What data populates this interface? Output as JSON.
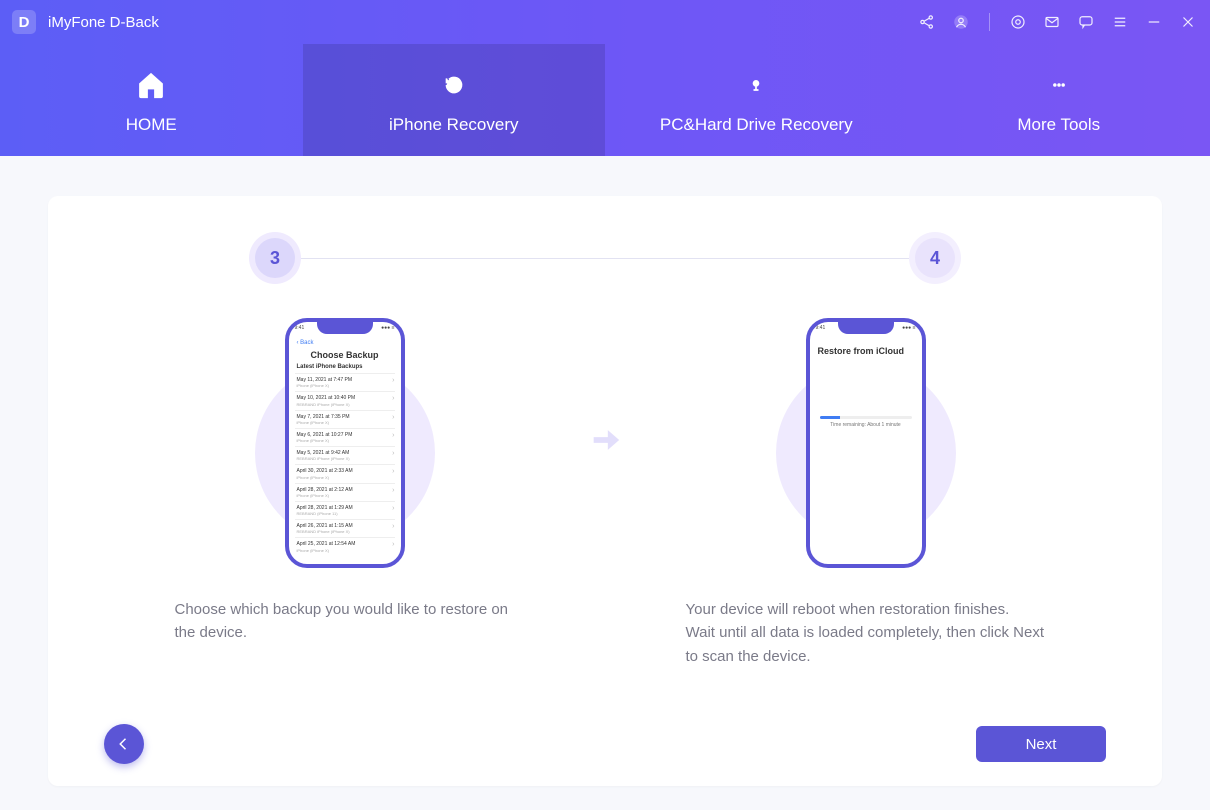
{
  "titlebar": {
    "app_name": "iMyFone D-Back"
  },
  "nav": {
    "home": "HOME",
    "iphone": "iPhone Recovery",
    "pc": "PC&Hard Drive Recovery",
    "more": "More Tools"
  },
  "steps": {
    "left_num": "3",
    "right_num": "4"
  },
  "panel3": {
    "phone_title": "Choose Backup",
    "phone_back": "‹ Back",
    "phone_section": "Latest iPhone Backups",
    "rows": [
      {
        "d": "May 11, 2021 at 7:47 PM",
        "s": "iPhone (iPhone X)"
      },
      {
        "d": "May 10, 2021 at 10:40 PM",
        "s": "REBRAND iPhone (iPhone X)"
      },
      {
        "d": "May 7, 2021 at 7:35 PM",
        "s": "iPhone (iPhone X)"
      },
      {
        "d": "May 6, 2021 at 10:27 PM",
        "s": "iPhone (iPhone X)"
      },
      {
        "d": "May 5, 2021 at 9:42 AM",
        "s": "REBRAND iPhone (iPhone X)"
      },
      {
        "d": "April 30, 2021 at 2:33 AM",
        "s": "iPhone (iPhone X)"
      },
      {
        "d": "April 28, 2021 at 2:12 AM",
        "s": "iPhone (iPhone X)"
      },
      {
        "d": "April 28, 2021 at 1:29 AM",
        "s": "REBRAND (iPhone 11)"
      },
      {
        "d": "April 26, 2021 at 1:15 AM",
        "s": "REBRAND iPhone (iPhone X)"
      },
      {
        "d": "April 25, 2021 at 12:54 AM",
        "s": "iPhone (iPhone X)"
      }
    ],
    "caption": "Choose which backup you would like to restore on the device."
  },
  "panel4": {
    "phone_title": "Restore from iCloud",
    "remaining": "Time remaining: About 1 minute",
    "caption": "Your device will reboot when restoration finishes.\nWait until all data is loaded completely, then click Next to scan the device."
  },
  "footer": {
    "next": "Next"
  }
}
